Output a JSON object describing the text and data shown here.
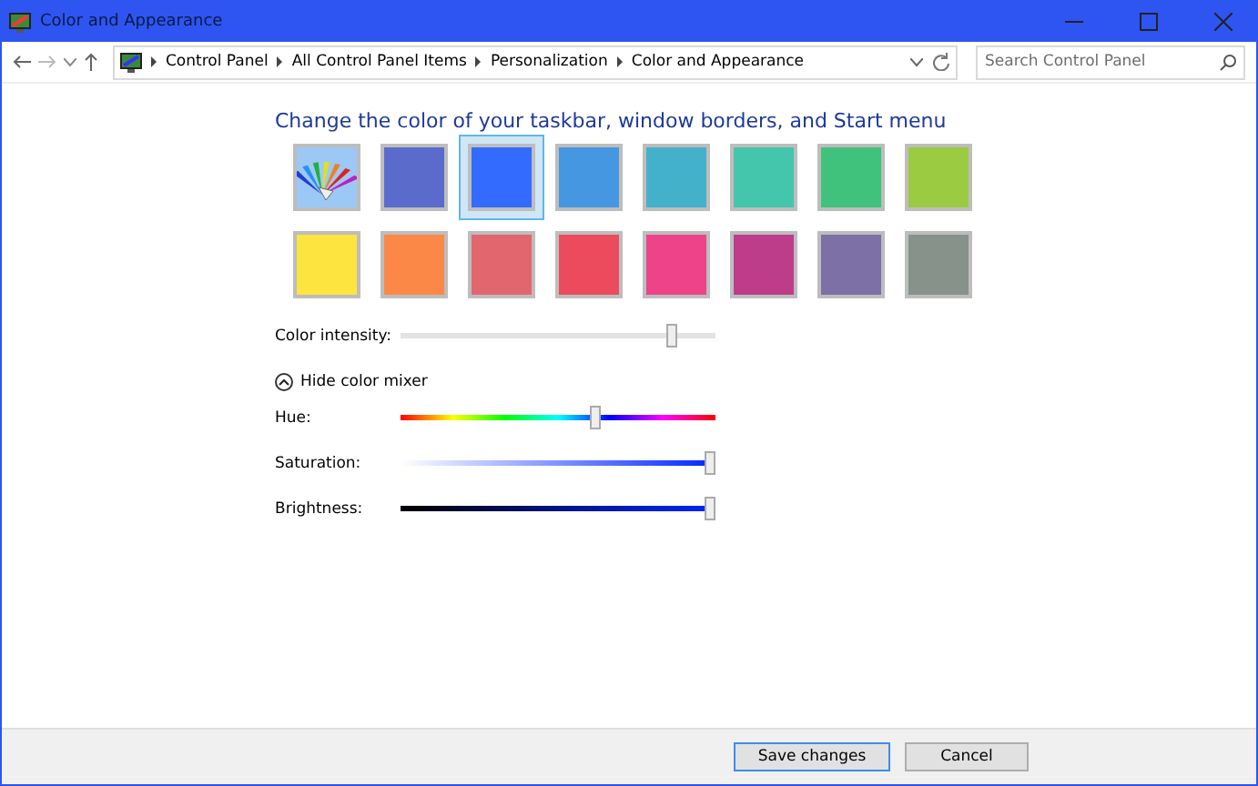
{
  "window": {
    "title": "Color and Appearance"
  },
  "breadcrumb": [
    "Control Panel",
    "All Control Panel Items",
    "Personalization",
    "Color and Appearance"
  ],
  "search": {
    "placeholder": "Search Control Panel"
  },
  "heading": "Change the color of your taskbar, window borders, and Start menu",
  "swatches": [
    {
      "kind": "custom",
      "selected": false
    },
    {
      "kind": "color",
      "color": "#5a6bcc",
      "selected": false
    },
    {
      "kind": "color",
      "color": "#346bff",
      "selected": true
    },
    {
      "kind": "color",
      "color": "#4497e0",
      "selected": false
    },
    {
      "kind": "color",
      "color": "#44b1cb",
      "selected": false
    },
    {
      "kind": "color",
      "color": "#43c6ab",
      "selected": false
    },
    {
      "kind": "color",
      "color": "#40c27c",
      "selected": false
    },
    {
      "kind": "color",
      "color": "#9bcb40",
      "selected": false
    },
    {
      "kind": "color",
      "color": "#fee43f",
      "selected": false
    },
    {
      "kind": "color",
      "color": "#fc8848",
      "selected": false
    },
    {
      "kind": "color",
      "color": "#e2666d",
      "selected": false
    },
    {
      "kind": "color",
      "color": "#ec4b5d",
      "selected": false
    },
    {
      "kind": "color",
      "color": "#ee4389",
      "selected": false
    },
    {
      "kind": "color",
      "color": "#bd3d8b",
      "selected": false
    },
    {
      "kind": "color",
      "color": "#7c70a6",
      "selected": false
    },
    {
      "kind": "color",
      "color": "#87928a",
      "selected": false
    }
  ],
  "intensity": {
    "label": "Color intensity:",
    "level": 0.86
  },
  "mixer_toggle": {
    "label": "Hide color mixer",
    "expanded": true
  },
  "mixer": [
    {
      "kind": "hue",
      "label": "Hue:",
      "level": 0.62
    },
    {
      "kind": "saturation",
      "label": "Saturation:",
      "level": 0.98
    },
    {
      "kind": "brightness",
      "label": "Brightness:",
      "level": 0.98
    }
  ],
  "buttons": [
    {
      "label": "Save changes",
      "default": true
    },
    {
      "label": "Cancel",
      "default": false
    }
  ]
}
